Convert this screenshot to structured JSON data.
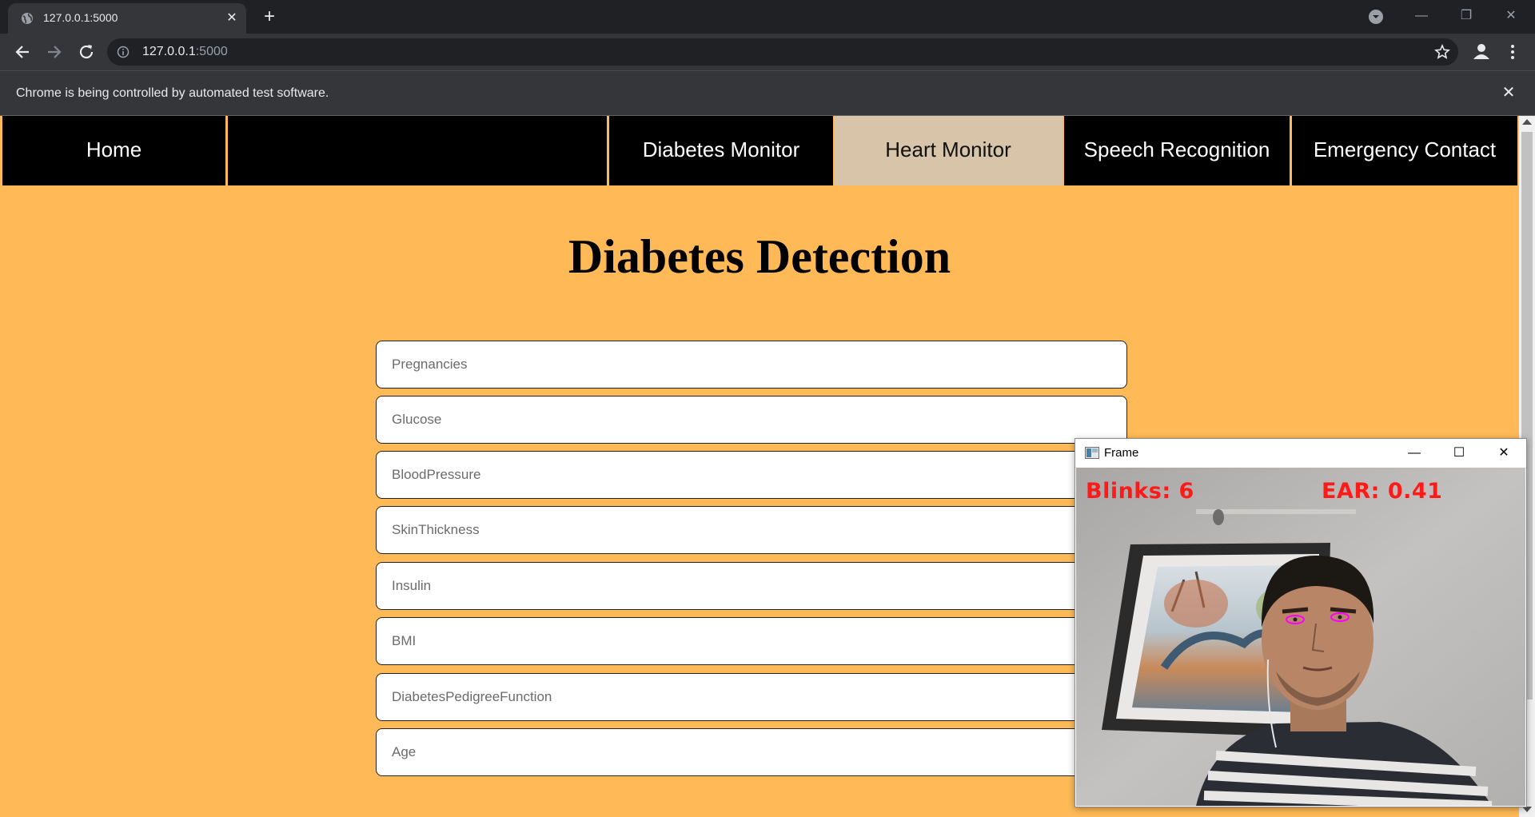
{
  "browser": {
    "tab_title": "127.0.0.1:5000",
    "url_host": "127.0.0.1",
    "url_port": ":5000",
    "infobar_text": "Chrome is being controlled by automated test software."
  },
  "nav": {
    "items": [
      {
        "label": "Home",
        "active": false
      },
      {
        "label": "",
        "active": false
      },
      {
        "label": "Diabetes Monitor",
        "active": false
      },
      {
        "label": "Heart Monitor",
        "active": true
      },
      {
        "label": "Speech Recognition",
        "active": false
      },
      {
        "label": "Emergency Contact",
        "active": false
      }
    ]
  },
  "page": {
    "title": "Diabetes Detection",
    "background_color": "#FFBA57"
  },
  "form": {
    "fields": [
      {
        "placeholder": "Pregnancies",
        "value": ""
      },
      {
        "placeholder": "Glucose",
        "value": ""
      },
      {
        "placeholder": "BloodPressure",
        "value": ""
      },
      {
        "placeholder": "SkinThickness",
        "value": ""
      },
      {
        "placeholder": "Insulin",
        "value": ""
      },
      {
        "placeholder": "BMI",
        "value": ""
      },
      {
        "placeholder": "DiabetesPedigreeFunction",
        "value": ""
      },
      {
        "placeholder": "Age",
        "value": ""
      }
    ]
  },
  "frame_window": {
    "title": "Frame",
    "blinks_text": "Blinks: 6",
    "ear_text": "EAR: 0.41",
    "overlay_color": "#ff1a1a",
    "eye_marker_color": "#ff00ff"
  }
}
